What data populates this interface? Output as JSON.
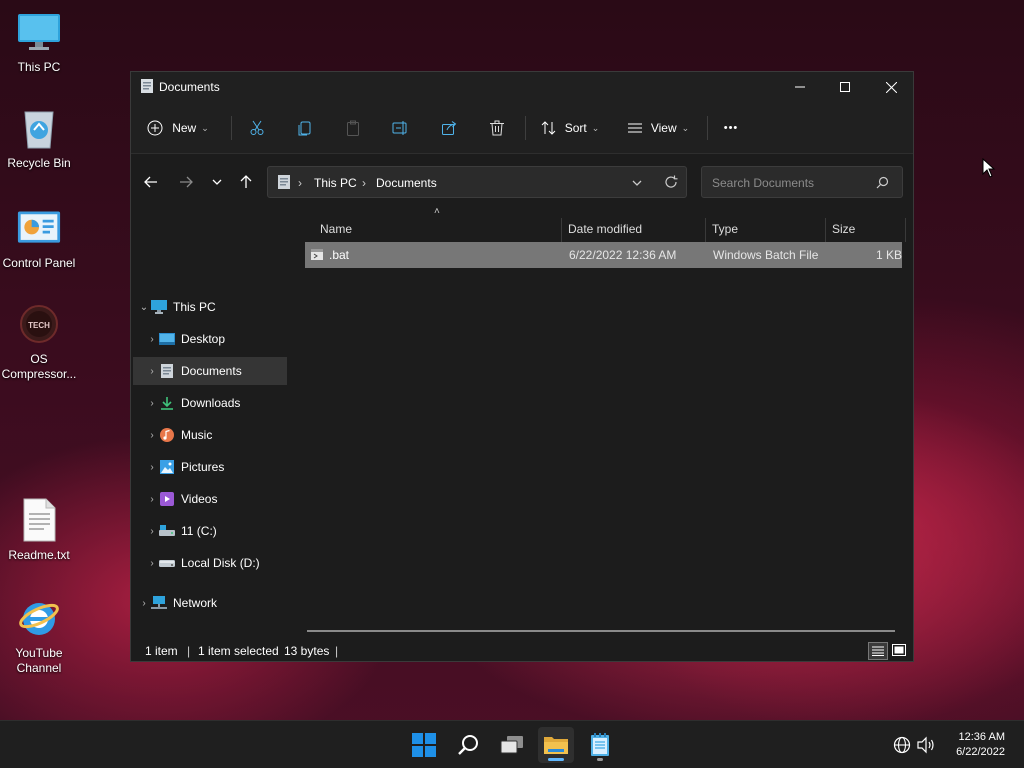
{
  "desktop": {
    "icons": [
      {
        "label": "This PC"
      },
      {
        "label": "Recycle Bin"
      },
      {
        "label": "Control Panel"
      },
      {
        "label": "OS Compressor..."
      },
      {
        "label": "Readme.txt"
      },
      {
        "label": "YouTube Channel"
      }
    ],
    "os_logo_text": "TECH"
  },
  "window": {
    "title": "Documents",
    "controls": {
      "minimize": "minimize-icon",
      "maximize": "maximize-icon",
      "close": "close-icon"
    }
  },
  "toolbar": {
    "new_label": "New",
    "sort_label": "Sort",
    "view_label": "View",
    "more_label": "•••",
    "icons": [
      "cut-icon",
      "copy-icon",
      "paste-icon",
      "rename-icon",
      "share-icon",
      "delete-icon"
    ]
  },
  "address": {
    "segments": [
      "This PC",
      "Documents"
    ],
    "separator": "›"
  },
  "search": {
    "placeholder": "Search Documents"
  },
  "nav": {
    "items": [
      {
        "label": "This PC",
        "icon": "monitor-icon"
      },
      {
        "label": "Desktop",
        "icon": "desktop-icon"
      },
      {
        "label": "Documents",
        "icon": "documents-icon",
        "selected": true
      },
      {
        "label": "Downloads",
        "icon": "download-icon"
      },
      {
        "label": "Music",
        "icon": "music-icon"
      },
      {
        "label": "Pictures",
        "icon": "pictures-icon"
      },
      {
        "label": "Videos",
        "icon": "videos-icon"
      },
      {
        "label": "11 (C:)",
        "icon": "drive-c-icon"
      },
      {
        "label": "Local Disk (D:)",
        "icon": "drive-d-icon"
      },
      {
        "label": "Network",
        "icon": "network-icon"
      }
    ]
  },
  "columns": {
    "name": "Name",
    "date": "Date modified",
    "type": "Type",
    "size": "Size"
  },
  "files": [
    {
      "name": ".bat",
      "date": "6/22/2022 12:36 AM",
      "type": "Windows Batch File",
      "size": "1 KB",
      "selected": true
    }
  ],
  "status": {
    "count": "1 item",
    "selected": "1 item selected",
    "bytes": "13 bytes",
    "sep": "|"
  },
  "taskbar": {
    "clock_time": "12:36 AM",
    "clock_date": "6/22/2022",
    "colors": {
      "accent": "#0078d4",
      "folder": "#f2c14e"
    }
  }
}
